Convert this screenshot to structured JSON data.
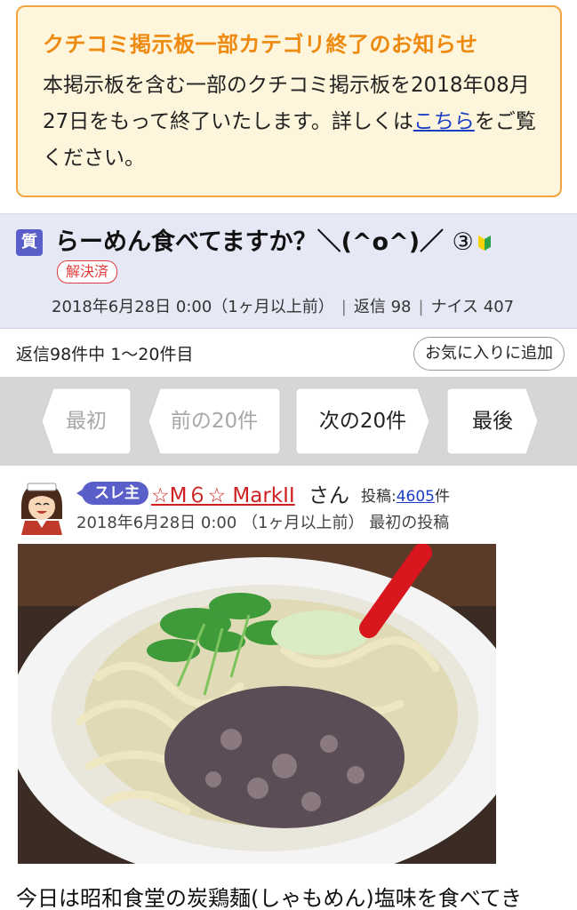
{
  "notice": {
    "title": "クチコミ掲示板一部カテゴリ終了のお知らせ",
    "body_before_link": "本掲示板を含む一部のクチコミ掲示板を2018年08月27日をもって終了いたします。詳しくは",
    "link_text": "こちら",
    "body_after_link": "をご覧ください。"
  },
  "thread": {
    "type_badge": "質",
    "title": "らーめん食べてますか？＼(^o^)／",
    "reply_badge": "③",
    "status_badge": "解決済",
    "date": "2018年6月28日 0:00（1ヶ月以上前）",
    "replies": "返信 98",
    "nice": "ナイス 407",
    "icons": {
      "type": "question-badge-icon",
      "beginner": "beginner-mark-icon"
    }
  },
  "list": {
    "count_text": "返信98件中 1〜20件目",
    "favorite_button": "お気に入りに追加"
  },
  "pager": {
    "first": "最初",
    "prev": "前の20件",
    "next": "次の20件",
    "last": "最後"
  },
  "post": {
    "op_badge": "スレ主",
    "name": "☆M６☆ MarkII",
    "honorific": "さん",
    "post_count_label": "投稿:",
    "post_count": "4605",
    "post_count_suffix": "件",
    "meta": "2018年6月28日 0:00 （1ヶ月以上前） 最初の投稿",
    "body_first_line": "今日は昭和食堂の炭鶏麺(しゃもめん)塩味を食べてき"
  },
  "colors": {
    "notice_border": "#f2a440",
    "notice_title": "#ee8a10",
    "accent_purple": "#5a5ec8",
    "solved_red": "#e23b3b",
    "link_blue": "#1a3fc4"
  }
}
